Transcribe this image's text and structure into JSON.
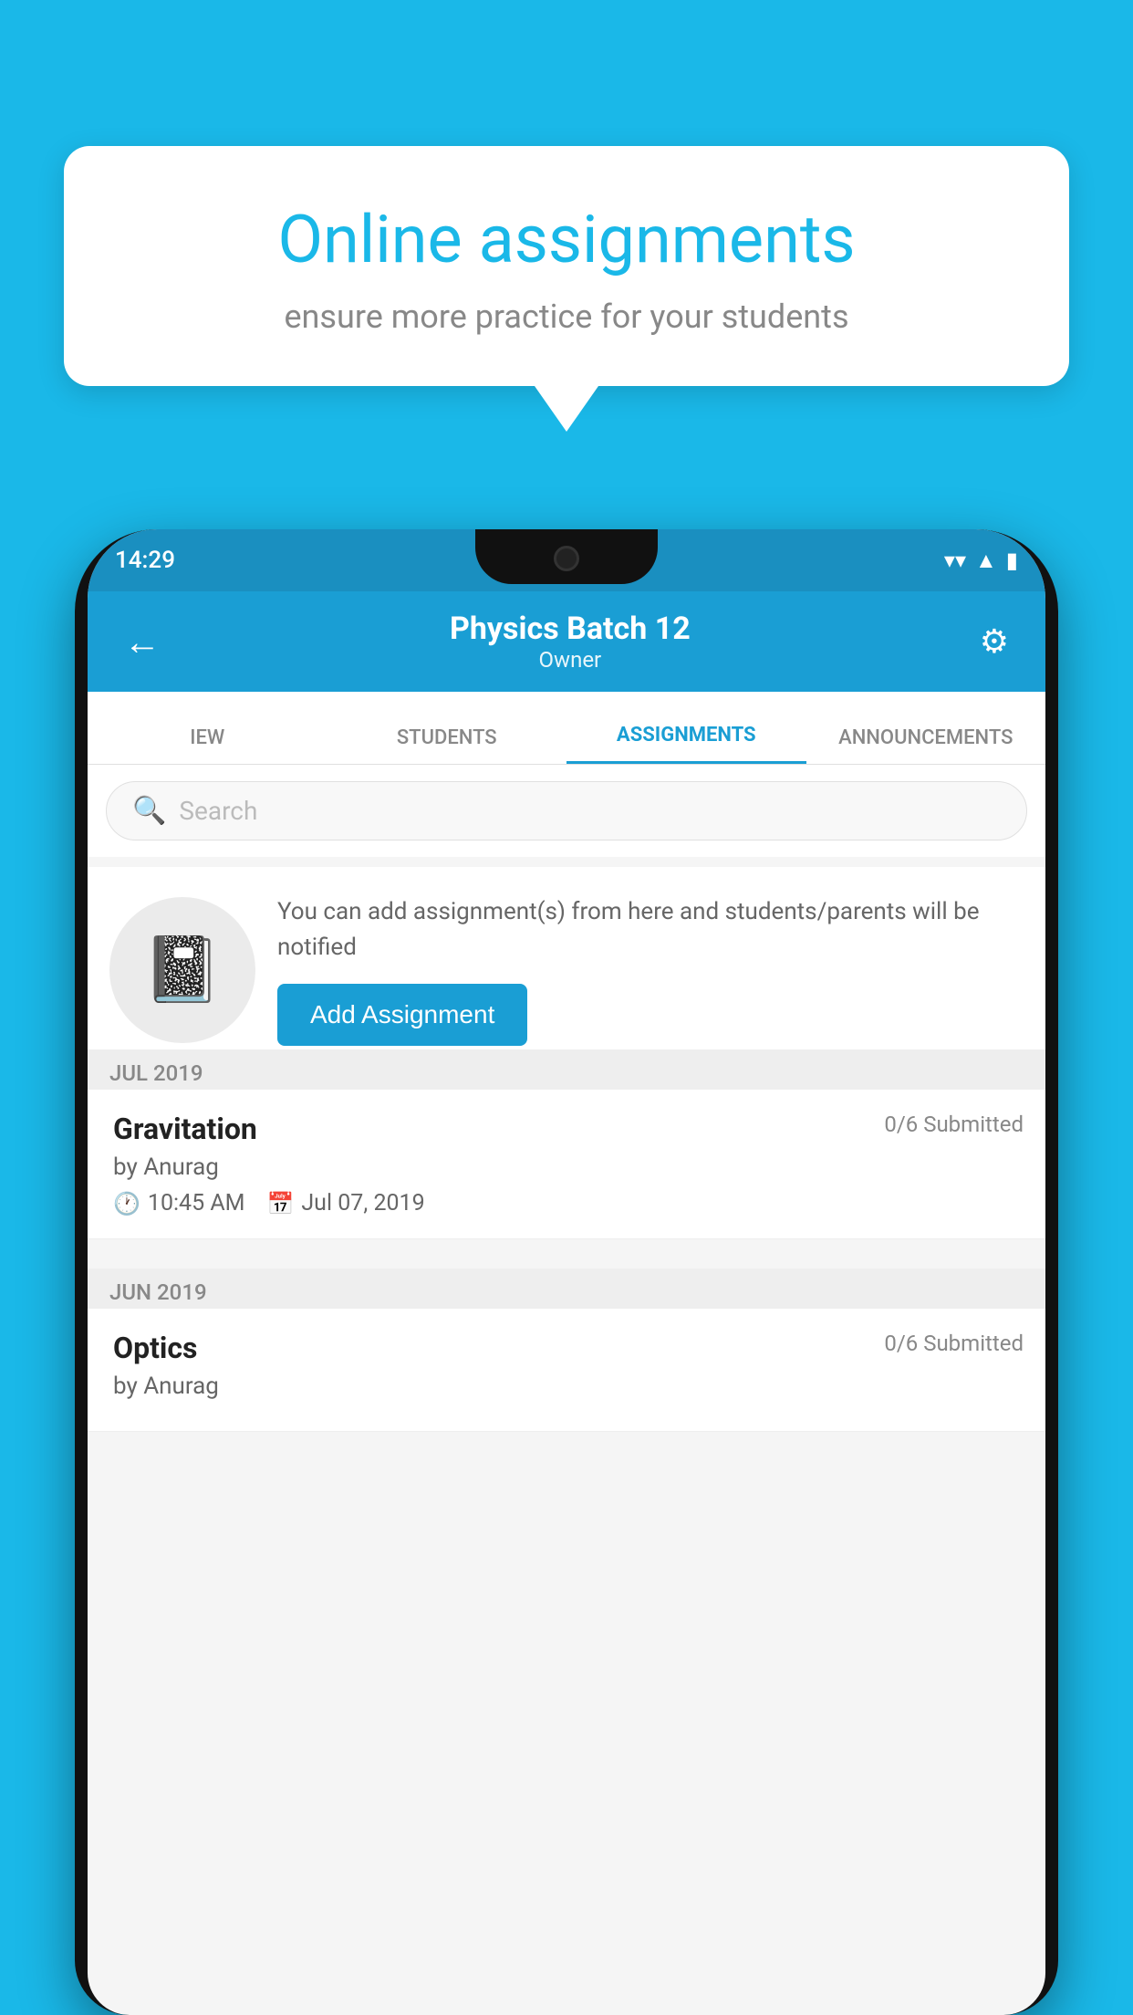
{
  "background_color": "#1ab8e8",
  "speech_bubble": {
    "title": "Online assignments",
    "subtitle": "ensure more practice for your students"
  },
  "status_bar": {
    "time": "14:29",
    "wifi": "▼",
    "signal": "◀",
    "battery": "▮"
  },
  "header": {
    "back_label": "←",
    "title": "Physics Batch 12",
    "subtitle": "Owner",
    "settings_label": "⚙"
  },
  "tabs": [
    {
      "id": "iew",
      "label": "IEW",
      "active": false
    },
    {
      "id": "students",
      "label": "STUDENTS",
      "active": false
    },
    {
      "id": "assignments",
      "label": "ASSIGNMENTS",
      "active": true
    },
    {
      "id": "announcements",
      "label": "ANNOUNCEMENTS",
      "active": false
    }
  ],
  "search": {
    "placeholder": "Search"
  },
  "add_assignment_section": {
    "description": "You can add assignment(s) from here and students/parents will be notified",
    "button_label": "Add Assignment"
  },
  "month_groups": [
    {
      "label": "JUL 2019",
      "assignments": [
        {
          "title": "Gravitation",
          "submitted": "0/6 Submitted",
          "author": "by Anurag",
          "time": "10:45 AM",
          "date": "Jul 07, 2019"
        }
      ]
    },
    {
      "label": "JUN 2019",
      "assignments": [
        {
          "title": "Optics",
          "submitted": "0/6 Submitted",
          "author": "by Anurag"
        }
      ]
    }
  ],
  "colors": {
    "primary": "#1a9ed4",
    "background": "#1ab8e8",
    "text_dark": "#222222",
    "text_medium": "#666666",
    "text_light": "#888888",
    "separator_bg": "#eeeeee"
  }
}
